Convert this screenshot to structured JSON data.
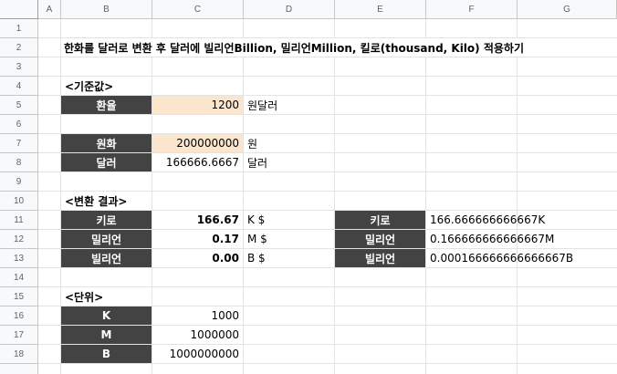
{
  "columns": [
    "A",
    "B",
    "C",
    "D",
    "E",
    "F",
    "G"
  ],
  "rows": [
    "1",
    "2",
    "3",
    "4",
    "5",
    "6",
    "7",
    "8",
    "9",
    "10",
    "11",
    "12",
    "13",
    "14",
    "15",
    "16",
    "17",
    "18"
  ],
  "title": "한화를 달러로 변환 후 달러에 빌리언Billion, 밀리언Million, 킬로(thousand, Kilo) 적용하기",
  "base": {
    "heading": "<기준값>",
    "rate_label": "환율",
    "rate_value": "1200",
    "rate_unit": "원달러",
    "krw_label": "원화",
    "krw_value": "200000000",
    "krw_unit": "원",
    "usd_label": "달러",
    "usd_value": "166666.6667",
    "usd_unit": "달러"
  },
  "result": {
    "heading": "<변환 결과>",
    "rows": [
      {
        "label": "키로",
        "value": "166.67",
        "unit": "K $",
        "label2": "키로",
        "value2": "166.666666666667K"
      },
      {
        "label": "밀리언",
        "value": "0.17",
        "unit": "M $",
        "label2": "밀리언",
        "value2": "0.166666666666667M"
      },
      {
        "label": "빌리언",
        "value": "0.00",
        "unit": "B $",
        "label2": "빌리언",
        "value2": "0.000166666666666667B"
      }
    ]
  },
  "units": {
    "heading": "<단위>",
    "rows": [
      {
        "label": "K",
        "value": "1000"
      },
      {
        "label": "M",
        "value": "1000000"
      },
      {
        "label": "B",
        "value": "1000000000"
      }
    ]
  },
  "colors": {
    "dark_header": "#434343",
    "input_fill": "#fce5cd",
    "grid": "#e2e3e3"
  }
}
